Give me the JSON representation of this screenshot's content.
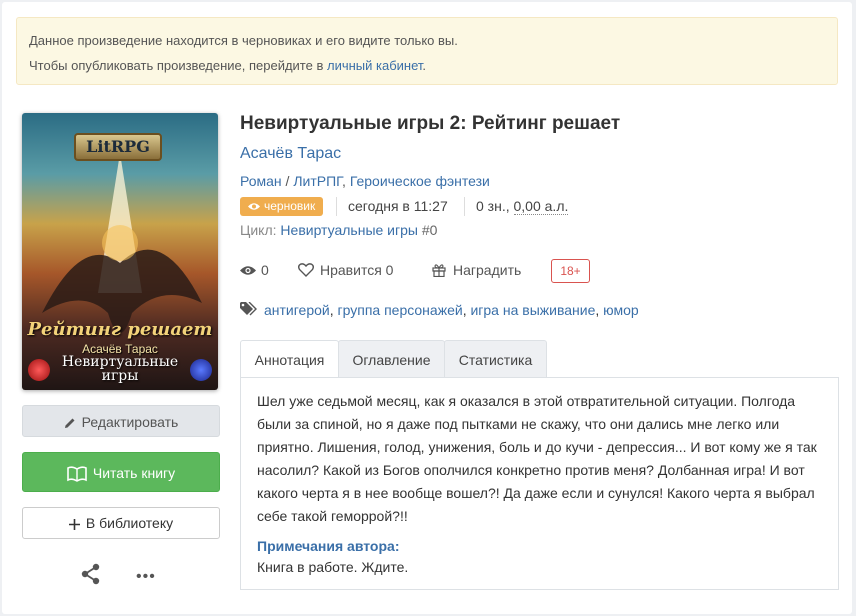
{
  "notice": {
    "line1": "Данное произведение находится в черновиках и его видите только вы.",
    "line2_prefix": "Чтобы опубликовать произведение, перейдите в ",
    "line2_link": "личный кабинет",
    "line2_suffix": "."
  },
  "cover": {
    "badge": "LitRPG",
    "title": "Рейтинг решает",
    "author": "Асачёв Тарас",
    "series_line1": "Невиртуальные",
    "series_line2": "игры"
  },
  "sidebar": {
    "edit_label": "Редактировать",
    "read_label": "Читать книгу",
    "library_label": "В библиотеку",
    "more_label": "•••"
  },
  "book": {
    "title": "Невиртуальные игры 2: Рейтинг решает",
    "author": "Асачёв Тарас",
    "genres": [
      "Роман",
      "ЛитРПГ",
      "Героическое фэнтези"
    ],
    "status": "черновик",
    "date": "сегодня в 11:27",
    "size_prefix": "0 зн., ",
    "size_value": "0,00 а.л.",
    "cycle_label": "Цикл:",
    "cycle_name": "Невиртуальные игры",
    "cycle_num": "#0"
  },
  "actions": {
    "views": "0",
    "likes_label": "Нравится",
    "likes": "0",
    "reward_label": "Наградить",
    "age": "18+"
  },
  "tags": [
    "антигерой",
    "группа персонажей",
    "игра на выживание",
    "юмор"
  ],
  "tabs": [
    "Аннотация",
    "Оглавление",
    "Статистика"
  ],
  "annotation": "Шел уже седьмой месяц, как я оказался в этой отвратительной ситуации. Полгода были за спиной, но я даже под пытками не скажу, что они дались мне легко или приятно. Лишения, голод, унижения, боль и до кучи - депрессия... И вот кому же я так насолил? Какой из Богов ополчился конкретно против меня? Долбанная игра! И вот какого черта я в нее вообще вошел?! Да даже если и сунулся! Какого черта я выбрал себе такой геморрой?!!",
  "notes": {
    "heading": "Примечания автора:",
    "text": "Книга в работе. Ждите."
  },
  "colors": {
    "link": "#3a6fa8",
    "read_button": "#5cb85c",
    "draft_badge": "#f0ad4e",
    "age_badge": "#d9534f",
    "notice_bg": "#fcf8e3"
  }
}
